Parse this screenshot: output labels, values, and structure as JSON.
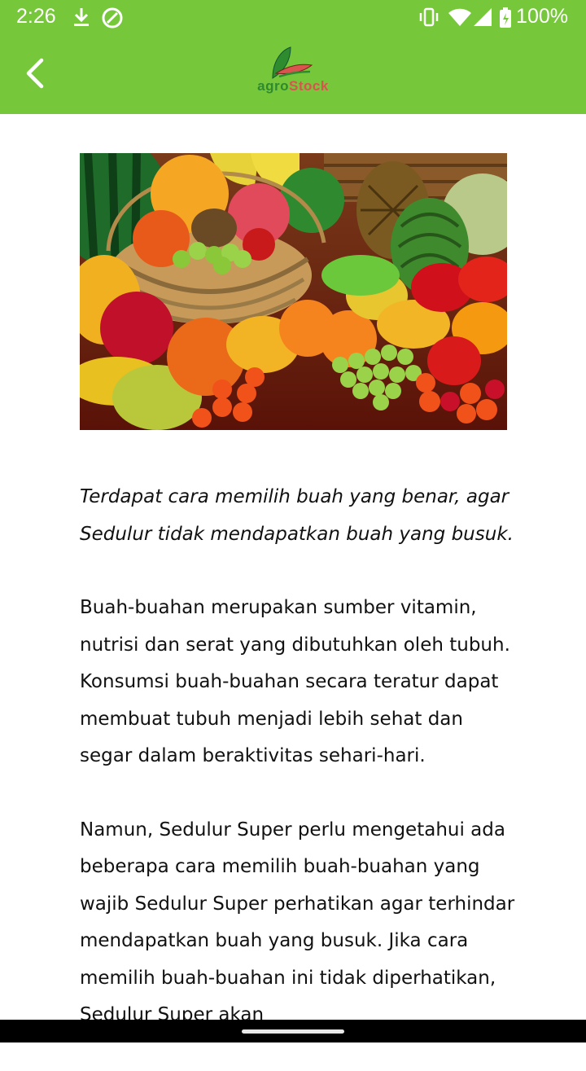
{
  "status_bar": {
    "time": "2:26",
    "battery": "100%",
    "icons": [
      "download-icon",
      "sync-icon",
      "vibrate-icon",
      "wifi-icon",
      "signal-icon",
      "battery-charging-icon"
    ]
  },
  "app_bar": {
    "back_icon": "chevron-left-icon",
    "logo": {
      "part1": "agro",
      "part2": "Stock"
    },
    "color": "#76c83a"
  },
  "hero_image": {
    "subject": "fruit-basket-image"
  },
  "article": {
    "lead": "Terdapat cara memilih buah yang benar, agar Sedulur tidak mendapatkan buah yang busuk.",
    "paragraph1": "Buah-buahan merupakan sumber vitamin, nutrisi dan serat yang dibutuhkan oleh tubuh. Konsumsi buah-buahan secara teratur dapat membuat tubuh menjadi lebih sehat dan segar dalam beraktivitas sehari-hari.",
    "paragraph2": "Namun, Sedulur Super perlu mengetahui ada beberapa cara memilih buah-buahan yang wajib Sedulur Super perhatikan agar terhindar mendapatkan buah yang busuk. Jika cara memilih buah-buahan ini tidak diperhatikan, Sedulur Super akan"
  }
}
